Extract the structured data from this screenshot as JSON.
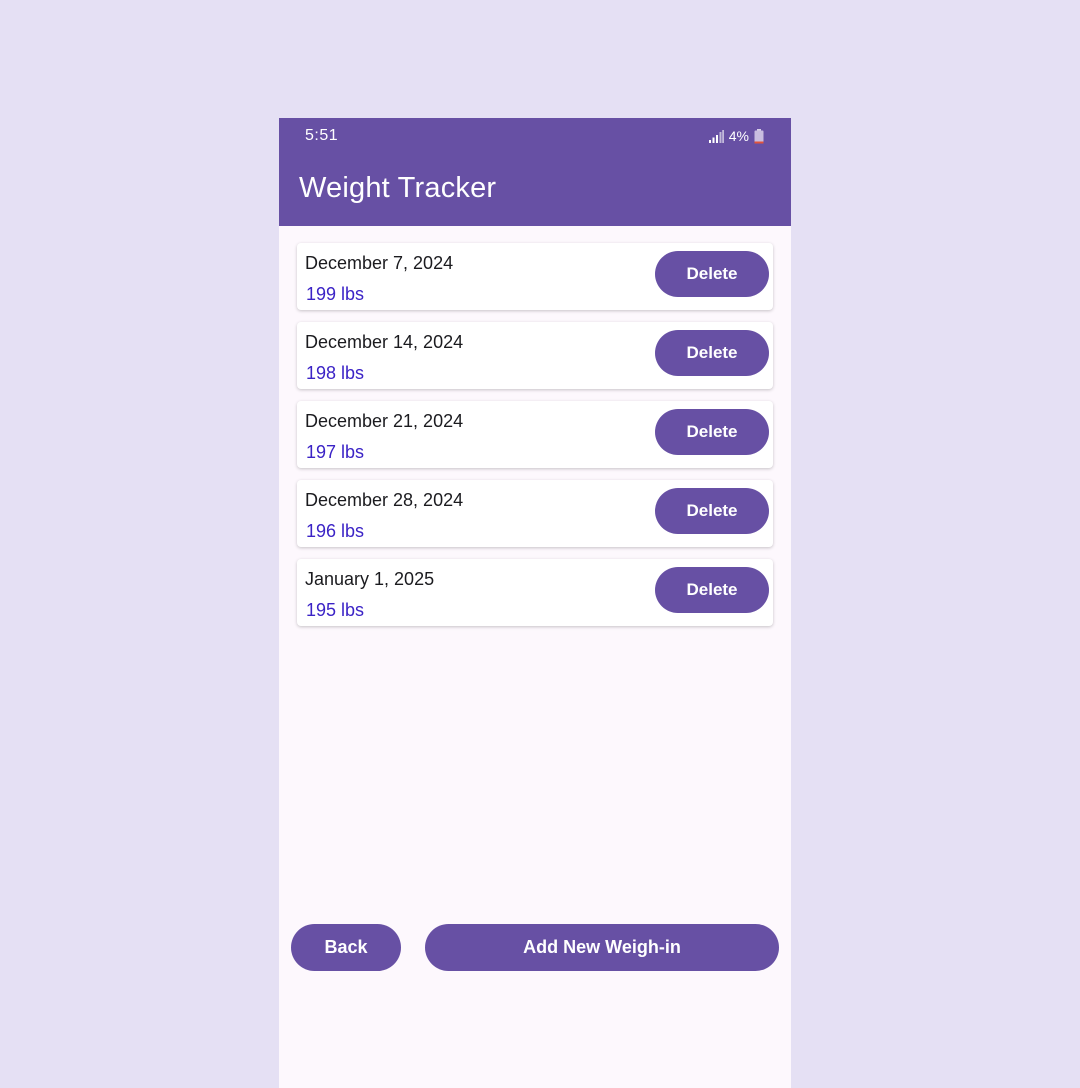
{
  "status_bar": {
    "time": "5:51",
    "battery": "4%",
    "icons": [
      "signal-icon",
      "battery-icon"
    ]
  },
  "header": {
    "title": "Weight Tracker"
  },
  "entries": [
    {
      "date": "December 7, 2024",
      "weight": "199 lbs",
      "delete_label": "Delete"
    },
    {
      "date": "December 14, 2024",
      "weight": "198 lbs",
      "delete_label": "Delete"
    },
    {
      "date": "December 21, 2024",
      "weight": "197 lbs",
      "delete_label": "Delete"
    },
    {
      "date": "December 28, 2024",
      "weight": "196 lbs",
      "delete_label": "Delete"
    },
    {
      "date": "January 1, 2025",
      "weight": "195 lbs",
      "delete_label": "Delete"
    }
  ],
  "actions": {
    "back_label": "Back",
    "add_label": "Add New Weigh-in"
  },
  "colors": {
    "primary": "#6750a4",
    "background": "#e5e0f4",
    "surface": "#fdf8fd",
    "weight_text": "#3b23c6"
  }
}
